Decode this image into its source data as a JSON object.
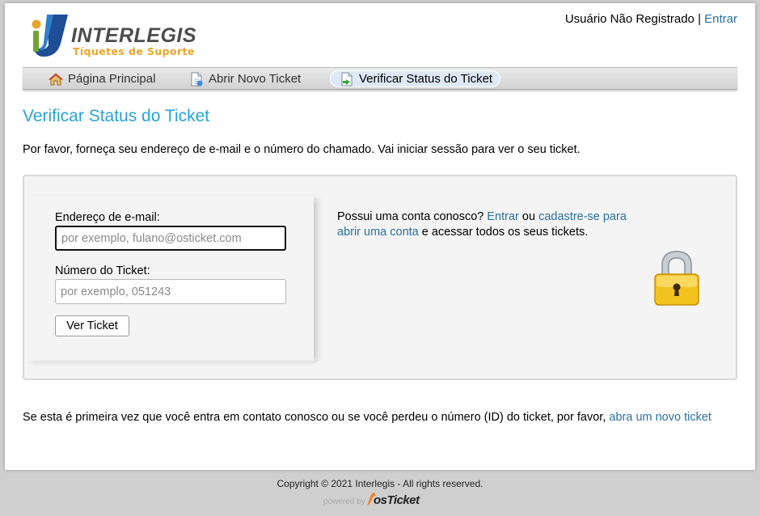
{
  "header": {
    "logo_name": "INTERLEGIS",
    "logo_tagline": "Tíquetes de Suporte",
    "user_status": "Usuário Não Registrado",
    "separator": "|",
    "signin_link": "Entrar"
  },
  "nav": {
    "items": [
      {
        "label": "Página Principal",
        "icon": "home-icon",
        "active": false
      },
      {
        "label": "Abrir Novo Ticket",
        "icon": "new-ticket-icon",
        "active": false
      },
      {
        "label": "Verificar Status do Ticket",
        "icon": "check-status-icon",
        "active": true
      }
    ]
  },
  "main": {
    "title": "Verificar Status do Ticket",
    "intro": "Por favor, forneça seu endereço de e-mail e o número do chamado. Vai iniciar sessão para ver o seu ticket.",
    "form": {
      "email_label": "Endereço de e-mail:",
      "email_placeholder": "por exemplo, fulano@osticket.com",
      "email_value": "",
      "ticket_label": "Número do Ticket:",
      "ticket_placeholder": "por exemplo, 051243",
      "ticket_value": "",
      "submit_label": "Ver Ticket"
    },
    "account": {
      "prefix": "Possui uma conta conosco?",
      "signin_link": "Entrar",
      "middle": "ou",
      "register_link": "cadastre-se para abrir uma conta",
      "suffix": "e acessar todos os seus tickets."
    },
    "footer_note": {
      "text": "Se esta é primeira vez que você entra em contato conosco ou se você perdeu o número (ID) do ticket, por favor,",
      "link": "abra um novo ticket"
    }
  },
  "footer": {
    "copyright": "Copyright © 2021 Interlegis - All rights reserved.",
    "powered_by": "powered by",
    "brand": "osTicket"
  },
  "colors": {
    "accent": "#28a3d6",
    "link": "#2a6f9d",
    "logo_gold": "#e9a52b",
    "logo_blue": "#1f4e96"
  }
}
